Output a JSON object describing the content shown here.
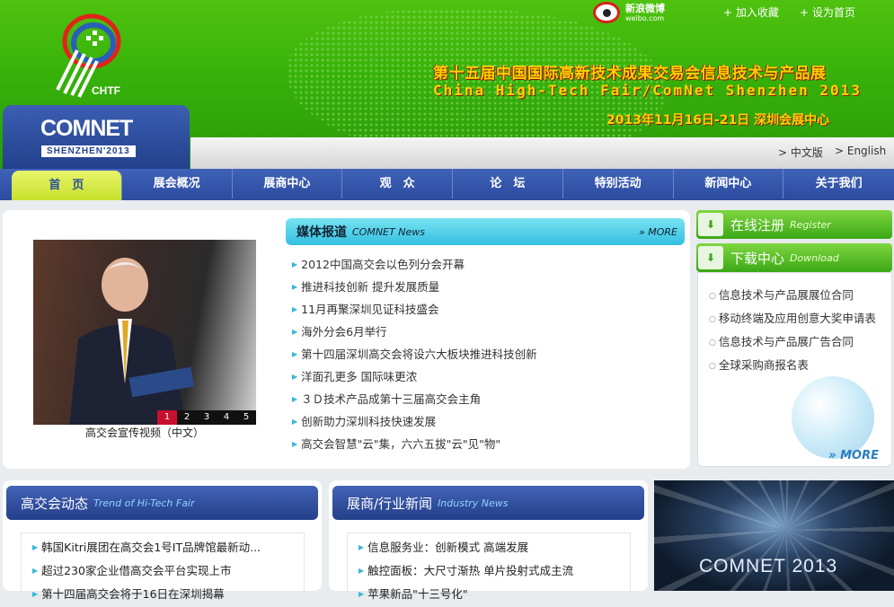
{
  "header": {
    "weibo_cn": "新浪微博",
    "weibo_url": "weibo.com",
    "add_favorite": "+ 加入收藏",
    "set_homepage": "+ 设为首页",
    "chtf_logo_text": "CHTF",
    "comnet_logo": "COMNET",
    "comnet_logo_sub": "SHENZHEN'2013",
    "hero_title_cn": "第十五届中国国际高新技术成果交易会信息技术与产品展",
    "hero_title_en": "China High-Tech Fair/ComNet Shenzhen 2013",
    "hero_date": "2013年11月16日-21日  深圳会展中心",
    "lang_cn": "> 中文版",
    "lang_en": "> English"
  },
  "nav": {
    "items": [
      "首　页",
      "展会概况",
      "展商中心",
      "观　众",
      "论　坛",
      "特别活动",
      "新闻中心",
      "关于我们"
    ],
    "active": "首　页"
  },
  "video": {
    "caption": "高交会宣传视频（中文）",
    "thumbs": [
      "1",
      "2",
      "3",
      "4",
      "5"
    ]
  },
  "media": {
    "title_cn": "媒体报道",
    "title_en": "COMNET News",
    "more": "» MORE",
    "items": [
      "2012中国高交会以色列分会开幕",
      "推进科技创新 提升发展质量",
      "11月再聚深圳见证科技盛会",
      "海外分会6月举行",
      "第十四届深圳高交会将设六大板块推进科技创新",
      "洋面孔更多 国际味更浓",
      "３Ｄ技术产品成第十三届高交会主角",
      "创新助力深圳科技快速发展",
      "高交会智慧\"云\"集，六六五拔\"云\"见\"物\""
    ]
  },
  "sidebar": {
    "register_cn": "在线注册",
    "register_en": "Register",
    "download_cn": "下载中心",
    "download_en": "Download",
    "downloads": [
      "信息技术与产品展展位合同",
      "移动终端及应用创意大奖申请表",
      "信息技术与产品展广告合同",
      "全球采购商报名表"
    ],
    "more": "» MORE"
  },
  "hitech": {
    "title_cn": "高交会动态",
    "title_en": "Trend of Hi-Tech Fair",
    "items": [
      "韩国Kitri展团在高交会1号IT品牌馆最新动...",
      "超过230家企业借高交会平台实现上市",
      "第十四届高交会将于16日在深圳揭幕"
    ]
  },
  "industry": {
    "title_cn": "展商/行业新闻",
    "title_en": "Industry News",
    "items": [
      "信息服务业：创新模式 高端发展",
      "触控面板：大尺寸渐热 单片投射式成主流",
      "苹果新品\"十三号化\""
    ]
  },
  "promo": {
    "text": "COMNET 2013"
  },
  "colors": {
    "header_green": "#37b10a",
    "nav_blue": "#2b4b9e",
    "accent_cyan": "#33bfe0",
    "hero_yellow": "#ffd200"
  }
}
